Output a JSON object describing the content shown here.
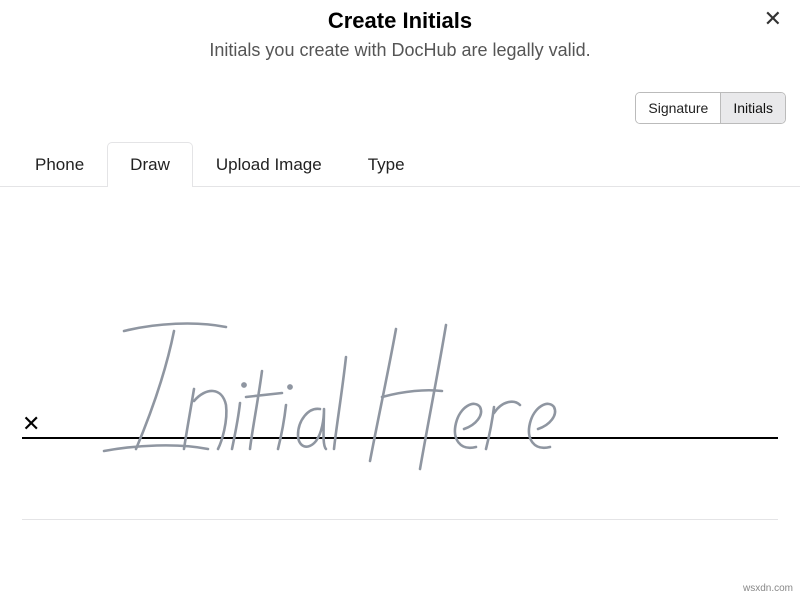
{
  "header": {
    "title": "Create Initials",
    "subtitle": "Initials you create with DocHub are legally valid."
  },
  "mode": {
    "signature": "Signature",
    "initials": "Initials",
    "active": "initials"
  },
  "tabs": {
    "phone": "Phone",
    "draw": "Draw",
    "upload": "Upload Image",
    "type": "Type",
    "active": "draw"
  },
  "canvas": {
    "placeholder": "Initial Here"
  },
  "watermark": "wsxdn.com"
}
